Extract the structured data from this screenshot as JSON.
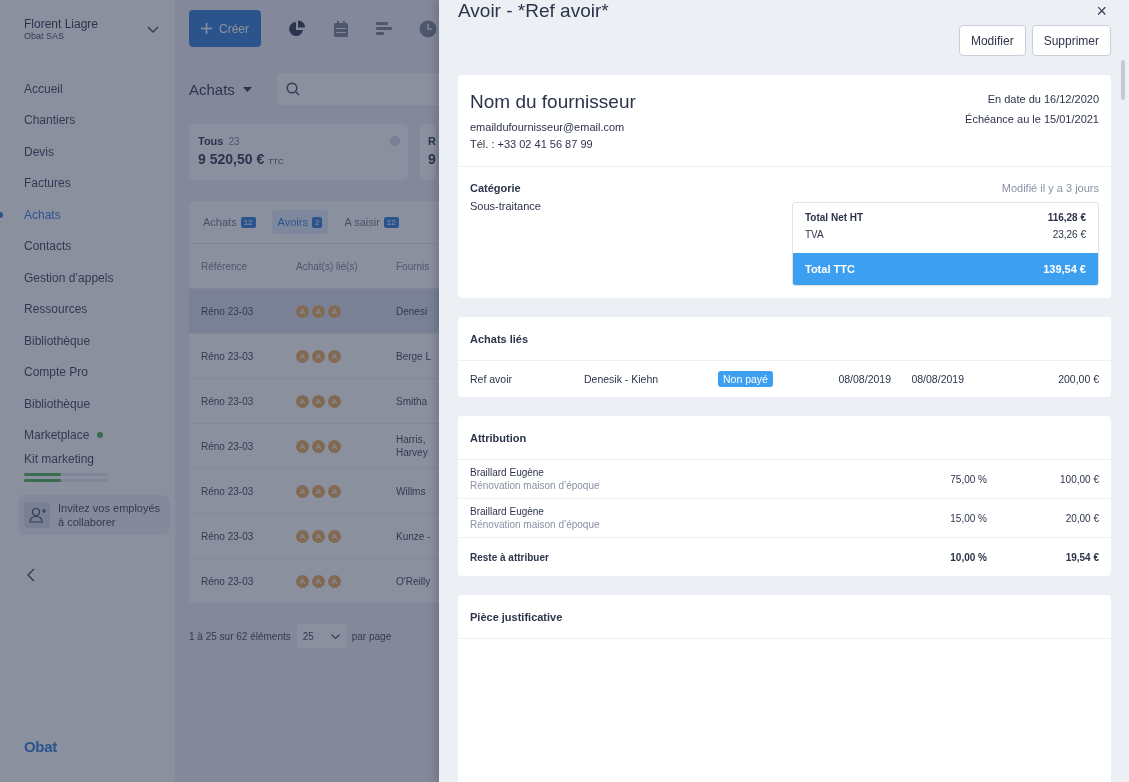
{
  "sidebar": {
    "user": {
      "name": "Florent Liagre",
      "company": "Obat SAS"
    },
    "items": [
      {
        "label": "Accueil",
        "selected": false,
        "new": false
      },
      {
        "label": "Chantiers",
        "selected": false,
        "new": false
      },
      {
        "label": "Devis",
        "selected": false,
        "new": false
      },
      {
        "label": "Factures",
        "selected": false,
        "new": false
      },
      {
        "label": "Achats",
        "selected": true,
        "new": false
      },
      {
        "label": "Contacts",
        "selected": false,
        "new": false
      },
      {
        "label": "Gestion d’appels",
        "selected": false,
        "new": false
      },
      {
        "label": "Ressources",
        "selected": false,
        "new": false
      },
      {
        "label": "Bibliothèque",
        "selected": false,
        "new": false
      },
      {
        "label": "Compte Pro",
        "selected": false,
        "new": false
      },
      {
        "label": "Bibliothèque",
        "selected": false,
        "new": false
      },
      {
        "label": "Marketplace",
        "selected": false,
        "new": true
      },
      {
        "label": "Kit marketing",
        "selected": false,
        "new": false,
        "progress": [
          {
            "level": 0.44
          },
          {
            "level": 0.44
          }
        ]
      }
    ],
    "invite": "Invitez vos employés à collaborer",
    "logo": "Obat"
  },
  "main": {
    "create_button": "Créer",
    "title": "Achats",
    "cards": [
      {
        "label": "Tous",
        "count": "23",
        "amount": "9 520,50 €",
        "unit": "TTC"
      },
      {
        "label": "R",
        "amount": "9"
      }
    ],
    "tabs": [
      {
        "label": "Achats",
        "count": "12",
        "selected": false
      },
      {
        "label": "Avoirs",
        "count": "2",
        "selected": true
      },
      {
        "label": "A saisir",
        "count": "12",
        "selected": false
      }
    ],
    "columns": [
      "Référence",
      "Achat(s) lié(s)",
      "Fournis"
    ],
    "rows": [
      {
        "reference": "Réno 23-03",
        "linked": [
          "A",
          "A",
          "A"
        ],
        "supplier": "Denesi",
        "selected": true
      },
      {
        "reference": "Réno 23-03",
        "linked": [
          "A",
          "A",
          "A"
        ],
        "supplier": "Berge L",
        "selected": false
      },
      {
        "reference": "Réno 23-03",
        "linked": [
          "A",
          "A",
          "A"
        ],
        "supplier": "Smitha",
        "selected": false
      },
      {
        "reference": "Réno 23-03",
        "linked": [
          "A",
          "A",
          "A"
        ],
        "supplier": "Harris, Harvey",
        "selected": false
      },
      {
        "reference": "Réno 23-03",
        "linked": [
          "A",
          "A",
          "A"
        ],
        "supplier": "Willms",
        "selected": false
      },
      {
        "reference": "Réno 23-03",
        "linked": [
          "A",
          "A",
          "A"
        ],
        "supplier": "Kunze -",
        "selected": false
      },
      {
        "reference": "Réno 23-03",
        "linked": [
          "A",
          "A",
          "A"
        ],
        "supplier": "O'Reilly",
        "selected": false
      }
    ],
    "pagination": {
      "summary": "1 à 25 sur 62 éléments",
      "per_page": "25",
      "suffix": "par page"
    }
  },
  "drawer": {
    "title": "Avoir - *Ref avoir*",
    "close": "×",
    "buttons": [
      "Modifier",
      "Supprimer"
    ],
    "supplier": {
      "name": "Nom du fournisseur",
      "email": "emaildufournisseur@email.com",
      "phone": "Tél. : +33 02 41 56 87 99"
    },
    "dates": [
      "En date du 16/12/2020",
      "Échéance au le 15/01/2021"
    ],
    "category": {
      "label": "Catégorie",
      "value": "Sous-traitance"
    },
    "modified": "Modifié il y a 3 jours",
    "totals": [
      {
        "label": "Total Net HT",
        "value": "116,28 €",
        "kind": "bold"
      },
      {
        "label": "TVA",
        "value": "23,26 €",
        "kind": "plain"
      },
      {
        "label": "Total TTC",
        "value": "139,54 €",
        "kind": "grand"
      }
    ],
    "linked": {
      "title": "Achats liés",
      "rows": [
        {
          "reference": "Ref avoir",
          "supplier": "Denesik - Kiehn",
          "status": "Non payé",
          "date": "08/08/2019",
          "due": "08/08/2019",
          "amount": "200,00 €"
        }
      ]
    },
    "attribution": {
      "title": "Attribution",
      "rows": [
        {
          "name": "Braillard Eugène",
          "project": "Rénovation maison d’époque",
          "percent": "75,00 %",
          "amount": "100,00 €",
          "kind": "line"
        },
        {
          "name": "Braillard Eugène",
          "project": "Rénovation maison d’époque",
          "percent": "15,00 %",
          "amount": "20,00 €",
          "kind": "line"
        },
        {
          "name": "Reste à attribuer",
          "percent": "10,00 %",
          "amount": "19,54 €",
          "kind": "total"
        }
      ]
    },
    "attachment": {
      "title": "Pièce justificative"
    }
  }
}
